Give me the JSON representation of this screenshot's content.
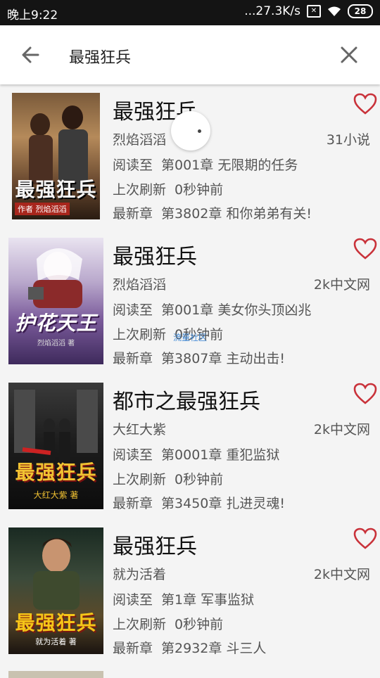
{
  "status_bar": {
    "time": "晚上9:22",
    "network_speed": "...27.3K/s",
    "battery": "28"
  },
  "search": {
    "query": "最强狂兵"
  },
  "books": [
    {
      "title": "最强狂兵",
      "author": "烈焰滔滔",
      "source": "31小说",
      "read_label": "阅读至",
      "read_chapter": "第001章 无限期的任务",
      "refresh_label": "上次刷新",
      "refresh_value": "0秒钟前",
      "latest_label": "最新章",
      "latest_chapter": "第3802章 和你弟弟有关!",
      "cover_text": "最强狂兵",
      "cover_sub": "作者 烈焰滔滔"
    },
    {
      "title": "最强狂兵",
      "author": "烈焰滔滔",
      "source": "2k中文网",
      "read_label": "阅读至",
      "read_chapter": "第001章 美女你头顶凶兆",
      "refresh_label": "上次刷新",
      "refresh_value": "0秒钟前",
      "latest_label": "最新章",
      "latest_chapter": "第3807章 主动出击!",
      "cover_text": "护花天王",
      "cover_sub": "烈焰滔滔 著"
    },
    {
      "title": "都市之最强狂兵",
      "author": "大红大紫",
      "source": "2k中文网",
      "read_label": "阅读至",
      "read_chapter": "第0001章 重犯监狱",
      "refresh_label": "上次刷新",
      "refresh_value": "0秒钟前",
      "latest_label": "最新章",
      "latest_chapter": "第3450章 扎进灵魂!",
      "cover_text": "最强狂兵",
      "cover_sub": "大红大紫 著"
    },
    {
      "title": "最强狂兵",
      "author": "就为活着",
      "source": "2k中文网",
      "read_label": "阅读至",
      "read_chapter": "第1章 军事监狱",
      "refresh_label": "上次刷新",
      "refresh_value": "0秒钟前",
      "latest_label": "最新章",
      "latest_chapter": "第2932章 斗三人",
      "cover_text": "最强狂兵",
      "cover_sub": "就为活着 著"
    }
  ],
  "watermark": "流量社区",
  "colors": {
    "heart": "#c9323a",
    "status_bar": "#141414",
    "background": "#f4f4f4"
  }
}
